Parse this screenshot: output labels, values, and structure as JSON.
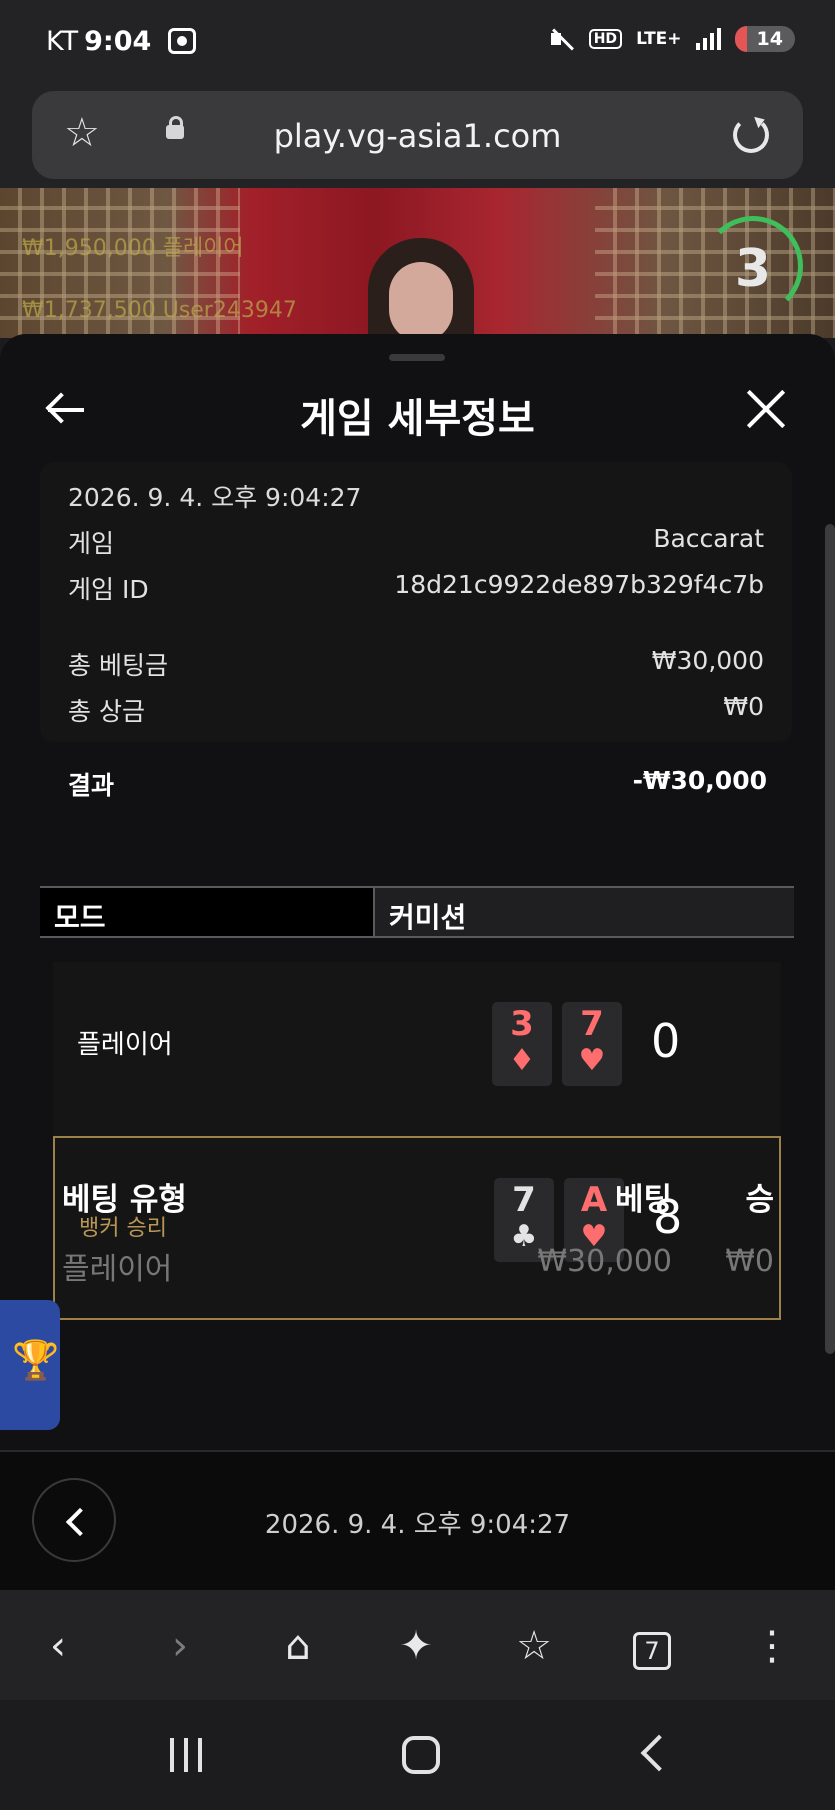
{
  "status_bar": {
    "carrier": "KT",
    "time": "9:04",
    "hd": "HD",
    "network": "LTE+",
    "battery": "14"
  },
  "browser": {
    "url": "play.vg-asia1.com",
    "tab_count": "7"
  },
  "game_backdrop": {
    "ticker1": "₩1,950,000 플레이어",
    "ticker2": "₩1,737,500 User243947",
    "countdown": "3"
  },
  "modal": {
    "title": "게임 세부정보",
    "datetime": "2026. 9. 4. 오후 9:04:27",
    "game_label": "게임",
    "game_value": "Baccarat",
    "game_id_label": "게임 ID",
    "game_id_value": "18d21c9922de897b329f4c7b",
    "total_bet_label": "총 베팅금",
    "total_bet_value": "₩30,000",
    "total_payout_label": "총 상금",
    "total_payout_value": "₩0",
    "result_label": "결과",
    "result_value": "-₩30,000",
    "mode_label": "모드",
    "mode_value": "커미션",
    "player": {
      "label": "플레이어",
      "cards": [
        {
          "rank": "3",
          "suit": "♦",
          "color": "#ff6e6e"
        },
        {
          "rank": "7",
          "suit": "♥",
          "color": "#ff6e6e"
        }
      ],
      "score": "0"
    },
    "banker": {
      "label": "뱅커 승리",
      "cards": [
        {
          "rank": "7",
          "suit": "♣",
          "color": "#e3e3e3"
        },
        {
          "rank": "A",
          "suit": "♥",
          "color": "#ff6e6e"
        }
      ],
      "score": "8"
    },
    "bets_header": {
      "type": "베팅 유형",
      "bet": "베팅",
      "win": "승"
    },
    "bets": [
      {
        "type": "플레이어",
        "bet": "₩30,000",
        "win": "₩0"
      }
    ]
  },
  "history_bar": {
    "datetime": "2026. 9. 4. 오후 9:04:27"
  },
  "colors": {
    "accent_gold": "#9c8148",
    "card_red": "#ff6e6e",
    "countdown_green": "#3fbf5c"
  }
}
